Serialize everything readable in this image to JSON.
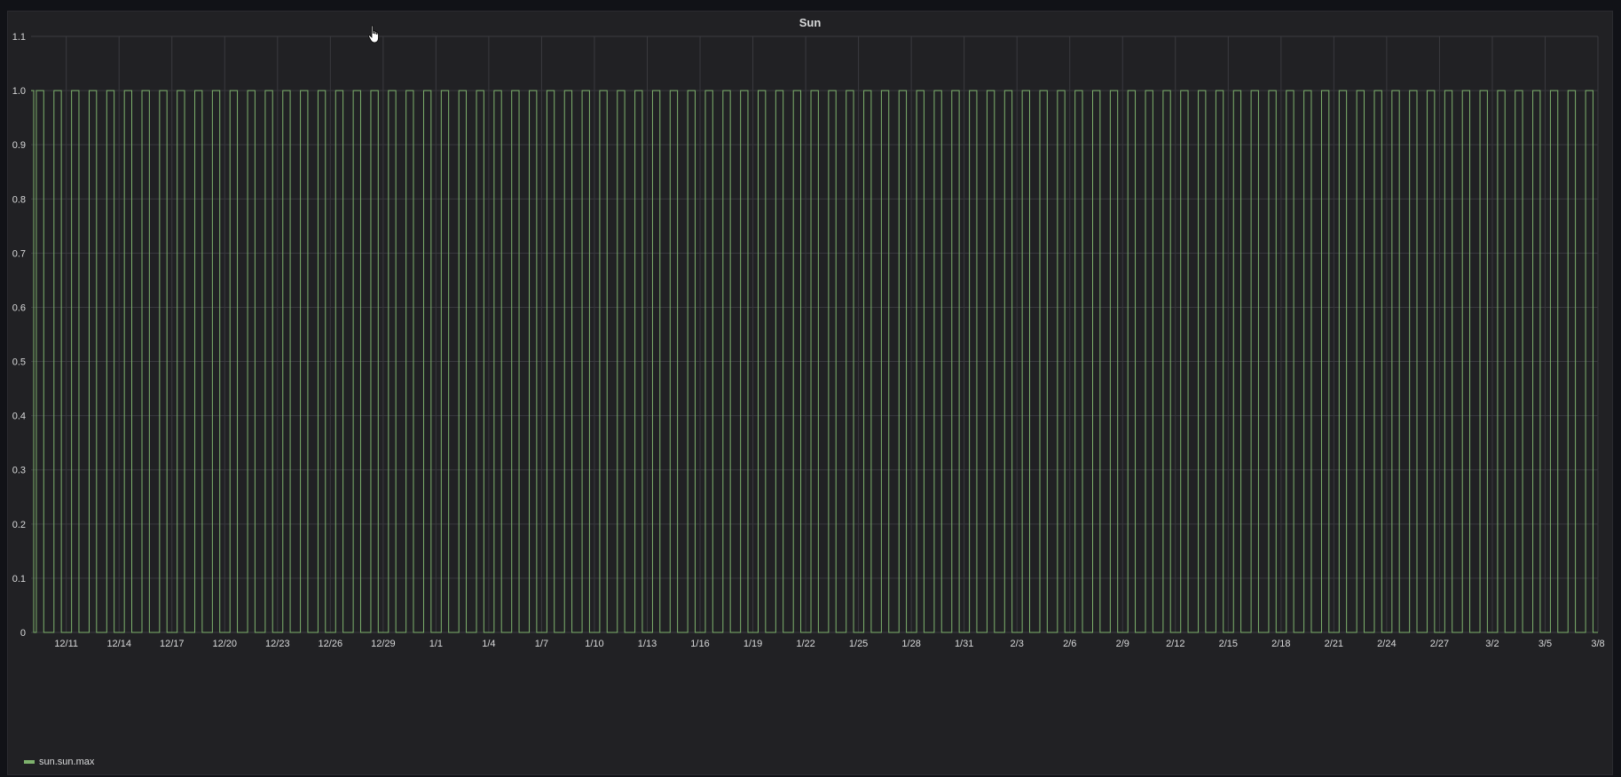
{
  "panel": {
    "title": "Sun"
  },
  "legend": {
    "series_label": "sun.sun.max"
  },
  "colors": {
    "series": "#7eb26d",
    "grid": "#3a3a3f",
    "axis_text": "#d8d9da",
    "background": "#212124"
  },
  "chart_data": {
    "type": "line",
    "title": "Sun",
    "xlabel": "",
    "ylabel": "",
    "ylim": [
      0,
      1.1
    ],
    "y_ticks": [
      "0",
      "0.1",
      "0.2",
      "0.3",
      "0.4",
      "0.5",
      "0.6",
      "0.7",
      "0.8",
      "0.9",
      "1.0",
      "1.1"
    ],
    "x_ticks": [
      "12/11",
      "12/14",
      "12/17",
      "12/20",
      "12/23",
      "12/26",
      "12/29",
      "1/1",
      "1/4",
      "1/7",
      "1/10",
      "1/13",
      "1/16",
      "1/19",
      "1/22",
      "1/25",
      "1/28",
      "1/31",
      "2/3",
      "2/6",
      "2/9",
      "2/12",
      "2/15",
      "2/18",
      "2/21",
      "2/24",
      "2/27",
      "3/2",
      "3/5",
      "3/8"
    ],
    "x_range": [
      "12/9",
      "3/8"
    ],
    "grid": true,
    "legend_position": "bottom-left",
    "series": [
      {
        "name": "sun.sun.max",
        "description": "Daily step signal: 1.0 during daytime, 0 at night, for every day from 12/9 to 3/8",
        "values": [
          0,
          1
        ]
      }
    ]
  }
}
